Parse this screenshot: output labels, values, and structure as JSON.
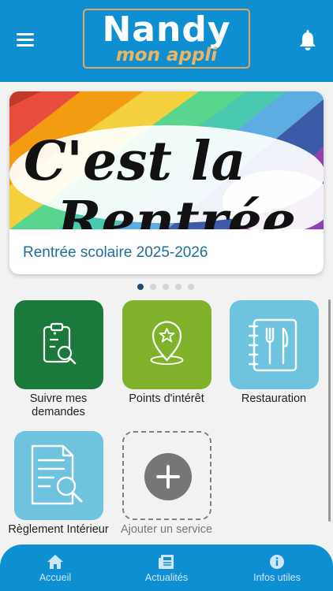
{
  "header": {
    "logo_title": "Nandy",
    "logo_subtitle": "mon appli",
    "menu_icon": "hamburger-menu-icon",
    "notifications_icon": "bell-icon",
    "color": "#0d8fd2"
  },
  "banner": {
    "image_text_line1": "C'est la",
    "image_text_line2": "Rentrée !",
    "caption": "Rentrée scolaire 2025-2026",
    "active_index": 0,
    "total_slides": 5
  },
  "services": [
    {
      "label": "Suivre mes demandes",
      "icon": "clipboard-search-icon",
      "color": "#1a7a3b"
    },
    {
      "label": "Points d'intérêt",
      "icon": "map-pin-star-icon",
      "color": "#7fb12b"
    },
    {
      "label": "Restauration",
      "icon": "menu-book-utensils-icon",
      "color": "#6fc3df"
    },
    {
      "label": "Règlement Intérieur",
      "icon": "document-search-icon",
      "color": "#6fc3df"
    }
  ],
  "add_service": {
    "label": "Ajouter un service",
    "icon": "plus-icon"
  },
  "tabbar": {
    "tabs": [
      {
        "label": "Accueil",
        "icon": "home-icon"
      },
      {
        "label": "Actualités",
        "icon": "newspaper-icon"
      },
      {
        "label": "Infos utiles",
        "icon": "info-icon"
      }
    ]
  }
}
